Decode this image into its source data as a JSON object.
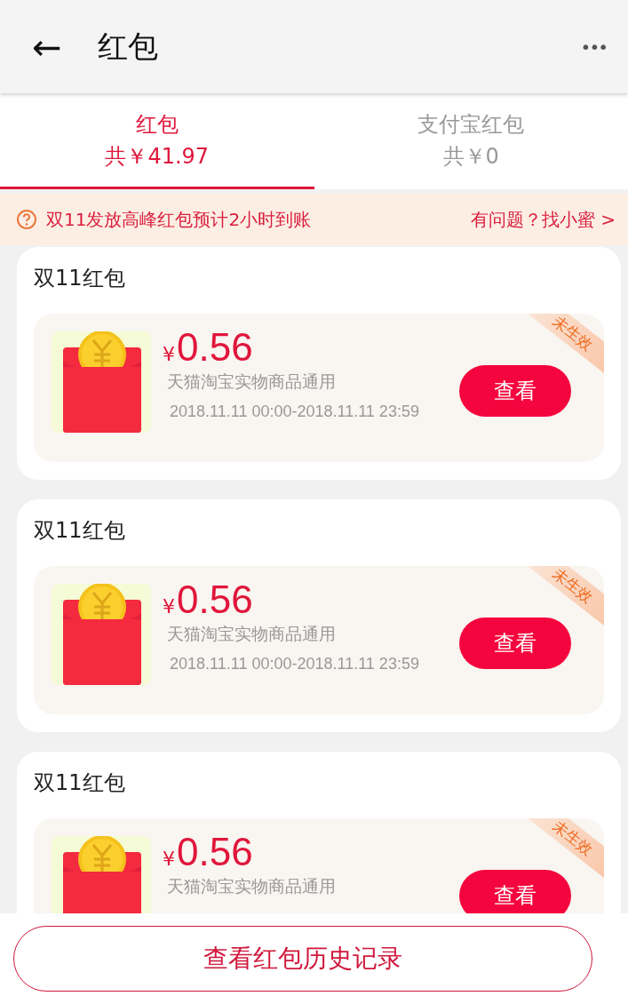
{
  "header": {
    "back": "←",
    "title": "红包",
    "more": "•••"
  },
  "tabs": [
    {
      "label": "红包",
      "total": "共￥41.97",
      "selected": true
    },
    {
      "label": "支付宝红包",
      "total": "共￥0",
      "selected": false
    }
  ],
  "notice": {
    "text": "双11发放高峰红包预计2小时到账",
    "link": "有问题？找小蜜 >"
  },
  "cards": [
    {
      "title": "双11红包",
      "currency": "¥",
      "amount": "0.56",
      "scope": "天猫淘宝实物商品通用",
      "period": "2018.11.11 00:00-2018.11.11 23:59",
      "status": "未生效",
      "button": "查看"
    },
    {
      "title": "双11红包",
      "currency": "¥",
      "amount": "0.56",
      "scope": "天猫淘宝实物商品通用",
      "period": "2018.11.11 00:00-2018.11.11 23:59",
      "status": "未生效",
      "button": "查看"
    },
    {
      "title": "双11红包",
      "currency": "¥",
      "amount": "0.56",
      "scope": "天猫淘宝实物商品通用",
      "status": "未生效",
      "button": "查看"
    }
  ],
  "footer_button": "查看红包历史记录"
}
